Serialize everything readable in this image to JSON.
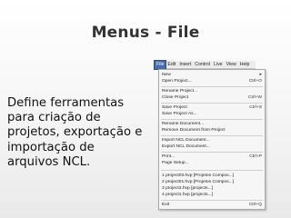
{
  "slide": {
    "title": "Menus - File",
    "body_lines": [
      "Define ferramentas",
      "para criação de",
      "projetos, exportação e",
      "importação de",
      "arquivos NCL."
    ]
  },
  "menubar": {
    "items": [
      "File",
      "Edit",
      "Insert",
      "Control",
      "Live",
      "View",
      "Help"
    ],
    "active_index": 0
  },
  "file_menu": {
    "items": [
      {
        "label": "New",
        "shortcut": "",
        "submenu": true
      },
      {
        "label": "Open Project...",
        "shortcut": "Ctrl+O"
      },
      {
        "label": "Rename Project...",
        "shortcut": ""
      },
      {
        "label": "Close Project",
        "shortcut": "Ctrl+W"
      },
      {
        "label": "Save Project",
        "shortcut": "Ctrl+S"
      },
      {
        "label": "Save Project As...",
        "shortcut": ""
      },
      {
        "label": "Rename Document...",
        "shortcut": ""
      },
      {
        "label": "Remove Document from Project",
        "shortcut": ""
      },
      {
        "label": "Import NCL Document...",
        "shortcut": ""
      },
      {
        "label": "Export NCL Document...",
        "shortcut": ""
      },
      {
        "label": "Print...",
        "shortcut": "Ctrl+P"
      },
      {
        "label": "Page Setup...",
        "shortcut": ""
      },
      {
        "label": "1 project03.hvp [Projetos Compos...]",
        "shortcut": ""
      },
      {
        "label": "2 project01.hvp [Projetos Compos...]",
        "shortcut": ""
      },
      {
        "label": "3 project3.hvp [projects...]",
        "shortcut": ""
      },
      {
        "label": "4 project1.hvp [projects...]",
        "shortcut": ""
      },
      {
        "label": "Exit",
        "shortcut": "Ctrl+Q"
      }
    ]
  },
  "colors": {
    "menu_highlight": "#4a6ea9",
    "title_text": "#333333"
  },
  "icons": {
    "submenu_arrow": "chevron-right-icon"
  }
}
